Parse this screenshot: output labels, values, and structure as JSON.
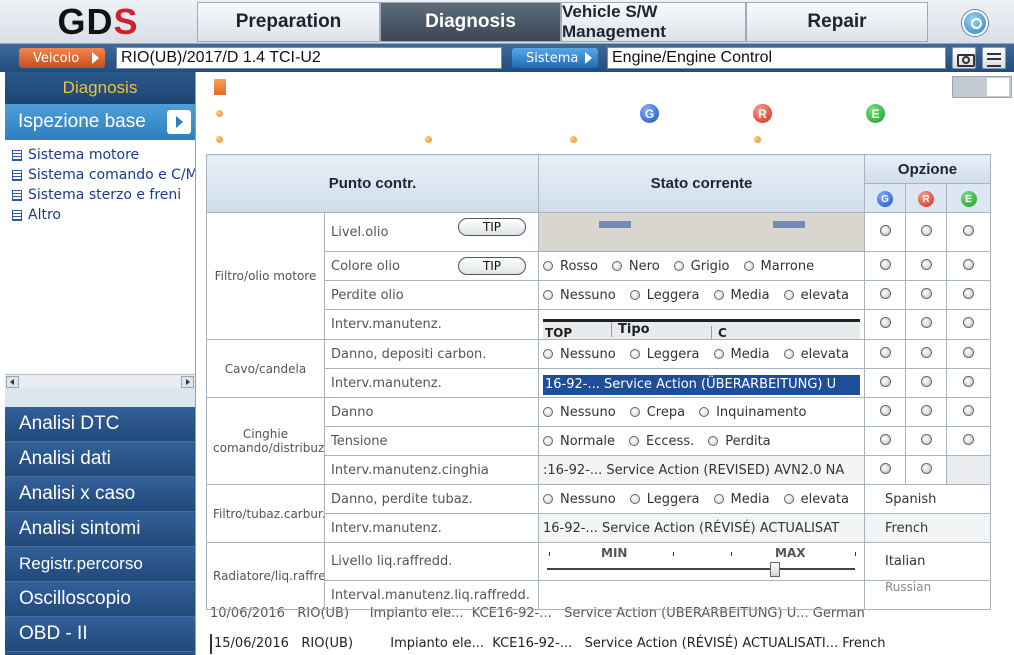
{
  "app": {
    "logo_text": "GDS"
  },
  "top_tabs": [
    {
      "label": "Preparation",
      "active": false
    },
    {
      "label": "Diagnosis",
      "active": true
    },
    {
      "label": "Vehicle S/W Management",
      "active": false
    },
    {
      "label": "Repair",
      "active": false
    }
  ],
  "selection": {
    "vehicle_label": "Veicolo",
    "vehicle_value": "RIO(UB)/2017/D 1.4 TCI-U2",
    "system_label": "Sistema",
    "system_value": "Engine/Engine Control"
  },
  "sidebar": {
    "header": "Diagnosis",
    "active_section": "Ispezione base",
    "tree": [
      "Sistema motore",
      "Sistema comando e C/M",
      "Sistema sterzo e freni",
      "Altro"
    ],
    "nav": [
      "Analisi DTC",
      "Analisi dati",
      "Analisi x caso",
      "Analisi sintomi",
      "Registr.percorso",
      "Oscilloscopio",
      "OBD - II"
    ]
  },
  "legend": {
    "g": "G",
    "r": "R",
    "e": "E"
  },
  "table": {
    "headers": {
      "check_point": "Punto contr.",
      "current_state": "Stato corrente",
      "options": "Opzione"
    },
    "tip": "TIP",
    "groups": {
      "oil": "Filtro/olio motore",
      "plug": "Cavo/candela",
      "belt": "Cinghie comando/distribuz.",
      "fuel": "Filtro/tubaz.carbur.",
      "radiator": "Radiatore/liq.raffredd."
    },
    "items": {
      "oil_level": "Livel.olio",
      "oil_color": "Colore olio",
      "oil_leak": "Perdite olio",
      "oil_interval": "Interv.manutenz.",
      "plug_damage": "Danno, depositi carbon.",
      "plug_interval": "Interv.manutenz.",
      "belt_damage": "Danno",
      "belt_tension": "Tensione",
      "belt_interval": "Interv.manutenz.cinghia",
      "fuel_leak": "Danno, perdite tubaz.",
      "fuel_interval": "Interv.manutenz.",
      "coolant_level": "Livello liq.raffredd.",
      "coolant_interval": "Interval.manutenz.liq.raffredd."
    },
    "choices": {
      "color": [
        "Rosso",
        "Nero",
        "Grigio",
        "Marrone"
      ],
      "leak": [
        "Nessuno",
        "Leggera",
        "Media",
        "elevata"
      ],
      "damage": [
        "Nessuno",
        "Crepa",
        "Inquinamento"
      ],
      "tension": [
        "Normale",
        "Eccess.",
        "Perdita"
      ]
    },
    "slider": {
      "min": "MIN",
      "max": "MAX",
      "value_fraction": 0.74
    },
    "overlay": {
      "col_top": "TOP",
      "col_tipo": "Tipo",
      "col_c": "C",
      "row1": "16-92-...    Service Action  (ÜBERARBEITUNG) U",
      "row2": ":16-92-...    Service Action  (REVISED) AVN2.0 NA",
      "row3": "16-92-...    Service Action  (RÉVISÉ) ACTUALISAT"
    },
    "languages": [
      "Spanish",
      "French",
      "Italian",
      "Russian"
    ]
  },
  "background_rows": [
    {
      "date": "10/06/2016",
      "car": "RIO(UB)",
      "plant": "Impianto ele...",
      "code": "KCE16-92-...",
      "desc": "Service Action  (ÜBERARBEITUNG) U...",
      "lang": "German"
    },
    {
      "date": "15/06/2016",
      "car": "RIO(UB)",
      "plant": "Impianto ele...",
      "code": "KCE16-92-...",
      "desc": "Service Action  (RÉVISÉ) ACTUALISATI...",
      "lang": "French"
    }
  ]
}
